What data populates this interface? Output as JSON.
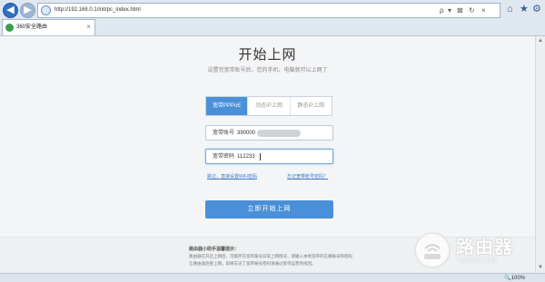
{
  "browser": {
    "url": "http://192.168.0.1/init/pc_index.html",
    "tab_label": "360安全路由",
    "nav": {
      "back": "◀",
      "forward": "▶"
    },
    "controls": {
      "search": "ρ",
      "dropdown": "▾",
      "lock": "⊠",
      "refresh": "↻",
      "close": "×"
    },
    "toolbar": {
      "home": "⌂",
      "favorites": "★",
      "settings": "⚙"
    },
    "tab_close": "×"
  },
  "page": {
    "title": "开始上网",
    "subtitle": "设置完宽带账号后，您的手机、电脑就可以上网了",
    "mode_tabs": [
      {
        "label": "宽带PPPoE",
        "active": true
      },
      {
        "label": "动态IP上网",
        "active": false
      },
      {
        "label": "静态IP上网",
        "active": false
      }
    ],
    "account": {
      "label": "宽带账号",
      "value": "390000"
    },
    "password": {
      "label": "宽带密码",
      "value": "112233"
    },
    "skip_link": "跳过，直接设置WiFi密码",
    "forgot_link": "忘记宽带账号密码？",
    "submit": "立即开始上网"
  },
  "footer": {
    "title": "路由器小助手温馨提示：",
    "lines": [
      "路由器在开启上网后，可能存在宽带账号异常上网情况，请输入本地宽带的正确账号和密码",
      "让路由器连接上网，如果忘记了宽带账号密码请通过宽带运营商找回。"
    ]
  },
  "watermark": {
    "text": "路由器",
    "url": "luyouqi.com"
  },
  "statusbar": {
    "zoom": "🔍100%"
  }
}
